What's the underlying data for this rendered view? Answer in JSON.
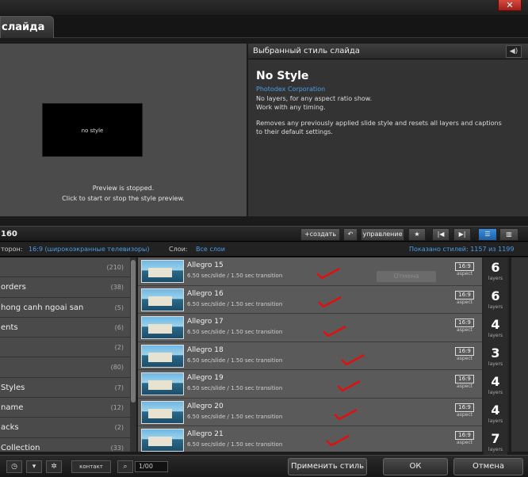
{
  "window": {
    "title": "слайда",
    "close_label": "✕"
  },
  "preview": {
    "screen_text": "no style",
    "line1": "Preview is stopped.",
    "line2": "Click to start or stop the style preview."
  },
  "style_panel": {
    "header": "Выбранный стиль слайда",
    "name": "No Style",
    "author": "Photodex Corporation",
    "desc1": "No layers, for any aspect ratio show.",
    "desc2": "Work with any timing.",
    "desc3": "Removes any previously applied slide style and resets all layers and captions",
    "desc4": "to their default settings."
  },
  "toolbar": {
    "count": "160",
    "create_label": "+создать",
    "manage_label": "управление"
  },
  "filters": {
    "ratio_label": "торон:",
    "ratio_value": "16:9 (широкоэкранные телевизоры)",
    "layers_label": "Слои:",
    "layers_value": "Все слои",
    "shown": "Показано стилей: 1157 из 1199"
  },
  "categories": [
    {
      "name": "",
      "count": "(210)"
    },
    {
      "name": "orders",
      "count": "(38)"
    },
    {
      "name": "hong canh ngoai san",
      "count": "(5)"
    },
    {
      "name": "ents",
      "count": "(6)"
    },
    {
      "name": "",
      "count": "(2)"
    },
    {
      "name": "",
      "count": "(80)"
    },
    {
      "name": "Styles",
      "count": "(7)"
    },
    {
      "name": "name",
      "count": "(12)"
    },
    {
      "name": "acks",
      "count": "(2)"
    },
    {
      "name": "Collection",
      "count": "(33)"
    }
  ],
  "ghost_label": "Отмена",
  "styles": [
    {
      "name": "Allegro 15",
      "info": "6.50 sec/slide / 1.50 sec transition",
      "aspect": "16:9",
      "aspect_label": "aspect",
      "layers": "6",
      "layers_label": "layers"
    },
    {
      "name": "Allegro 16",
      "info": "6.50 sec/slide / 1.50 sec transition",
      "aspect": "16:9",
      "aspect_label": "aspect",
      "layers": "6",
      "layers_label": "layers"
    },
    {
      "name": "Allegro 17",
      "info": "6.50 sec/slide / 1.50 sec transition",
      "aspect": "16:9",
      "aspect_label": "aspect",
      "layers": "4",
      "layers_label": "layers"
    },
    {
      "name": "Allegro 18",
      "info": "6.50 sec/slide / 1.50 sec transition",
      "aspect": "16:9",
      "aspect_label": "aspect",
      "layers": "3",
      "layers_label": "layers"
    },
    {
      "name": "Allegro 19",
      "info": "6.50 sec/slide / 1.50 sec transition",
      "aspect": "16:9",
      "aspect_label": "aspect",
      "layers": "4",
      "layers_label": "layers"
    },
    {
      "name": "Allegro 20",
      "info": "6.50 sec/slide / 1.50 sec transition",
      "aspect": "16:9",
      "aspect_label": "aspect",
      "layers": "4",
      "layers_label": "layers"
    },
    {
      "name": "Allegro 21",
      "info": "6.50 sec/slide / 1.50 sec transition",
      "aspect": "16:9",
      "aspect_label": "aspect",
      "layers": "7",
      "layers_label": "layers"
    }
  ],
  "bottom": {
    "list_label": "контакт",
    "search_value": "1/00",
    "apply_label": "Применить стиль",
    "ok_label": "ОК",
    "cancel_label": "Отмена"
  },
  "colors": {
    "accent": "#4a9ee8",
    "check": "#e01010"
  }
}
